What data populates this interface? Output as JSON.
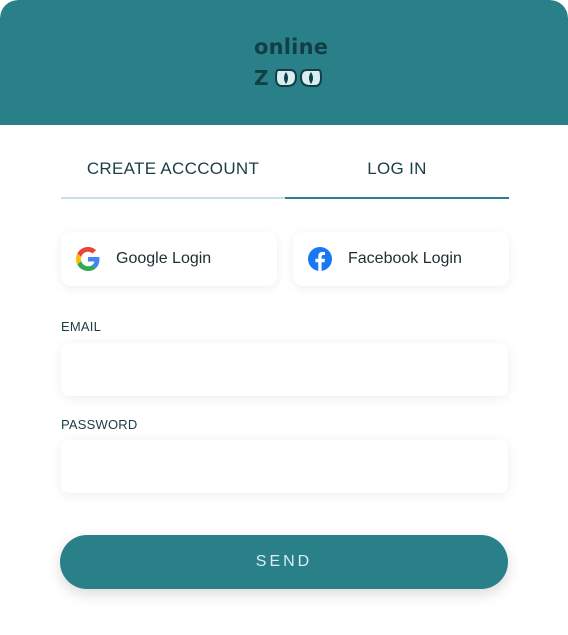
{
  "brand": {
    "logo_top": "online",
    "logo_bottom_letter": "Z",
    "header_color": "#2a8088",
    "logo_color": "#123f45",
    "icons": [
      "left-eye-icon",
      "right-eye-icon"
    ]
  },
  "tabs": [
    {
      "label": "CREATE ACCCOUNT",
      "active": false
    },
    {
      "label": "LOG IN",
      "active": true
    }
  ],
  "social": {
    "google": {
      "label": "Google Login",
      "icon": "google-icon"
    },
    "facebook": {
      "label": "Facebook Login",
      "icon": "facebook-icon"
    }
  },
  "form": {
    "email": {
      "label": "EMAIL",
      "value": "",
      "placeholder": ""
    },
    "password": {
      "label": "PASSWORD",
      "value": "",
      "placeholder": ""
    },
    "send_label": "SEND"
  }
}
